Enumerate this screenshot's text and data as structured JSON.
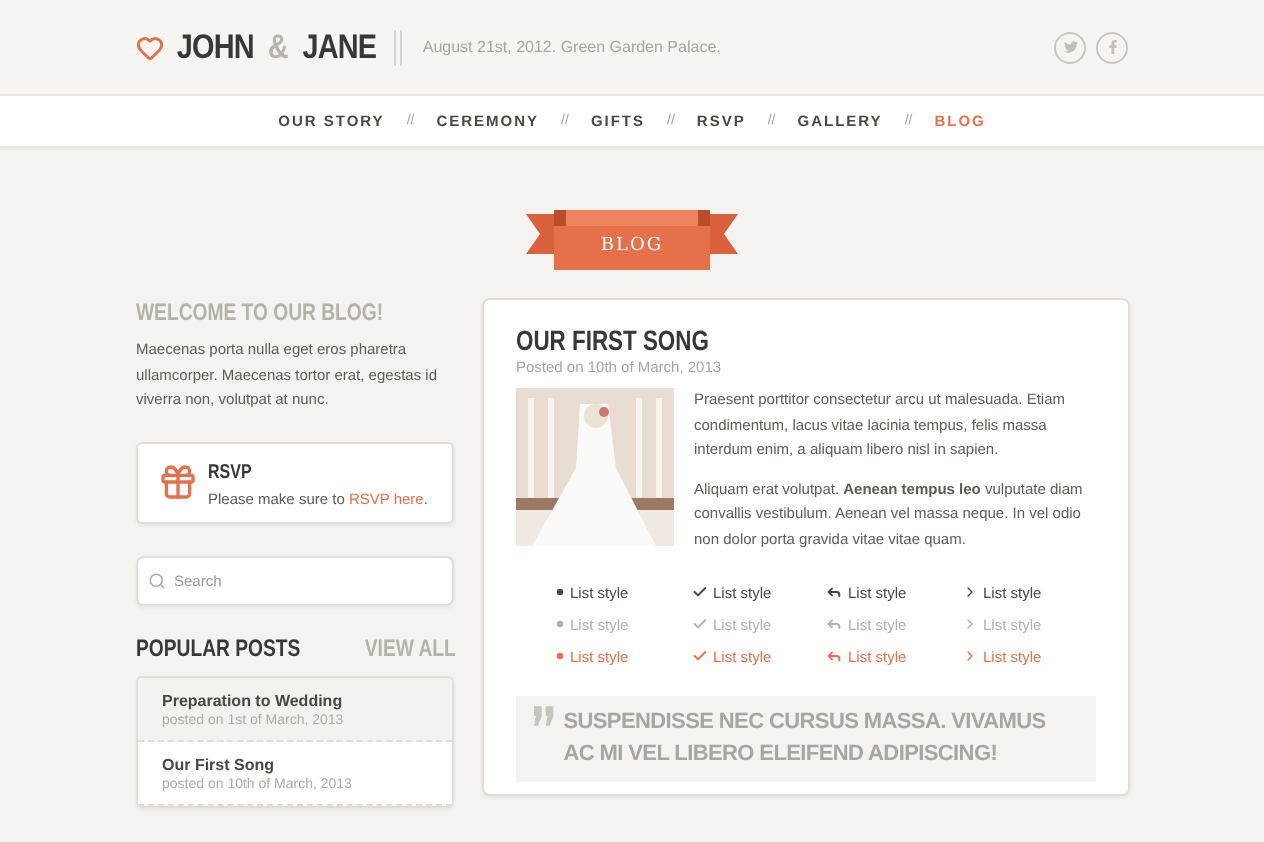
{
  "header": {
    "brand_first": "JOHN",
    "brand_amp": "&",
    "brand_second": "JANE",
    "tagline": "August 21st, 2012. Green Garden Palace."
  },
  "nav": [
    {
      "label": "OUR STORY",
      "selected": false
    },
    {
      "label": "CEREMONY",
      "selected": false
    },
    {
      "label": "GIFTS",
      "selected": false
    },
    {
      "label": "RSVP",
      "selected": false
    },
    {
      "label": "GALLERY",
      "selected": false
    },
    {
      "label": "BLOG",
      "selected": true
    }
  ],
  "nav_separator": "//",
  "banner": "BLOG",
  "sidebar": {
    "welcome_title": "WELCOME TO OUR BLOG!",
    "welcome_text": "Maecenas porta nulla eget eros pharetra ullamcorper. Maecenas tortor erat, egestas id viverra non, volutpat at nunc.",
    "rsvp": {
      "title": "RSVP",
      "text": "Please make sure to ",
      "link": "RSVP here",
      "after": "."
    },
    "search": {
      "placeholder": "Search"
    },
    "popular_title": "POPULAR POSTS",
    "view_all": "VIEW ALL",
    "posts": [
      {
        "title": "Preparation to Wedding",
        "date": "posted on 1st of March, 2013",
        "selected": true
      },
      {
        "title": "Our First Song",
        "date": "posted on 10th of March, 2013",
        "selected": false
      }
    ]
  },
  "post": {
    "title": "OUR FIRST SONG",
    "date": "Posted on 10th of March, 2013",
    "image": {
      "kind": "picture"
    },
    "paragraphs": [
      "Praesent porttitor consectetur arcu ut malesuada. Etiam condimentum, lacus vitae lacinia tempus, felis massa interdum enim, a aliquam libero nisl in sapien.",
      "Aliquam erat volutpat. **Aenean tempus leo** vulputate diam convallis vestibulum. Aenean vel massa neque. In vel odio non dolor porta gravida vitae vitae quam."
    ],
    "list_columns": [
      {
        "kind": "dot",
        "items": [
          {
            "text": "List style",
            "color": "#4b4843"
          },
          {
            "text": "List style",
            "color": "#b5b0a8"
          },
          {
            "text": "List style",
            "color": "#e5714a"
          }
        ]
      },
      {
        "kind": "check",
        "items": [
          {
            "text": "List style",
            "color": "#4b4843"
          },
          {
            "text": "List style",
            "color": "#b5b0a8"
          },
          {
            "text": "List style",
            "color": "#e5714a"
          }
        ]
      },
      {
        "kind": "reply",
        "items": [
          {
            "text": "List style",
            "color": "#4b4843"
          },
          {
            "text": "List style",
            "color": "#b5b0a8"
          },
          {
            "text": "List style",
            "color": "#e5714a"
          }
        ]
      },
      {
        "kind": "chevron",
        "items": [
          {
            "text": "List style",
            "color": "#4b4843"
          },
          {
            "text": "List style",
            "color": "#b5b0a8"
          },
          {
            "text": "List style",
            "color": "#e5714a"
          }
        ]
      }
    ],
    "quote": "SUSPENDISSE NEC CURSUS MASSA. VIVAMUS AC MI VEL LIBERO ELEIFEND ADIPISCING!"
  }
}
